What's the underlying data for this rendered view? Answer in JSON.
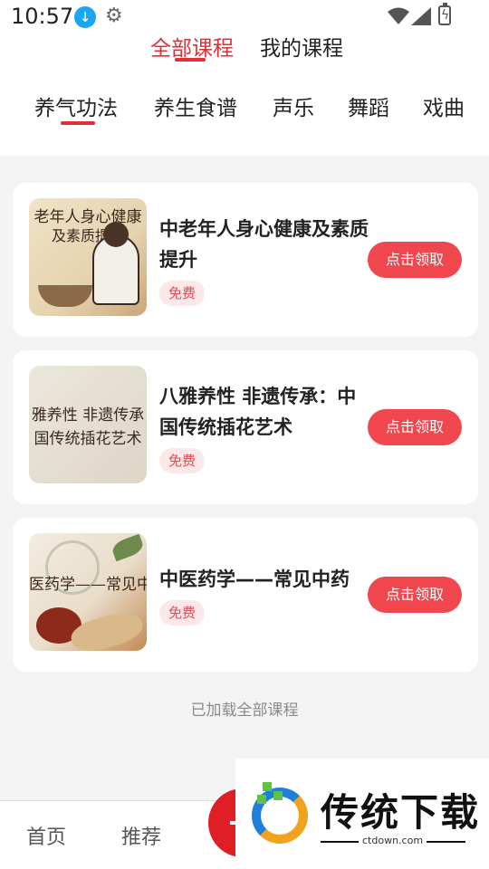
{
  "status_bar": {
    "time": "10:57",
    "icons": [
      "download-icon",
      "gear-icon",
      "wifi-icon",
      "signal-icon",
      "battery-charging-icon"
    ]
  },
  "main_tabs": [
    {
      "label": "全部课程",
      "active": true
    },
    {
      "label": "我的课程",
      "active": false
    }
  ],
  "category_tabs": [
    {
      "label": "养气功法",
      "active": true
    },
    {
      "label": "养生食谱",
      "active": false
    },
    {
      "label": "声乐",
      "active": false
    },
    {
      "label": "舞蹈",
      "active": false
    },
    {
      "label": "戏曲",
      "active": false
    }
  ],
  "courses": [
    {
      "title": "中老年人身心健康及素质提升",
      "badge": "免费",
      "button": "点击领取",
      "thumb_lines": [
        "老年人身心健康",
        "及素质提升"
      ]
    },
    {
      "title": "八雅养性 非遗传承：中国传统插花艺术",
      "badge": "免费",
      "button": "点击领取",
      "thumb_lines": [
        "雅养性 非遗传承",
        "国传统插花艺术"
      ]
    },
    {
      "title": "中医药学——常见中药",
      "badge": "免费",
      "button": "点击领取",
      "thumb_lines": [
        "医药学——常见中"
      ]
    }
  ],
  "footer_message": "已加载全部课程",
  "bottom_nav": [
    {
      "label": "首页"
    },
    {
      "label": "推荐"
    }
  ],
  "watermark": {
    "brand": "传统下载",
    "url": "ctdown.com"
  },
  "colors": {
    "accent": "#e42d36",
    "button": "#f0474f",
    "badge_bg": "#fbe8e8",
    "page_bg": "#f3f3f4"
  }
}
